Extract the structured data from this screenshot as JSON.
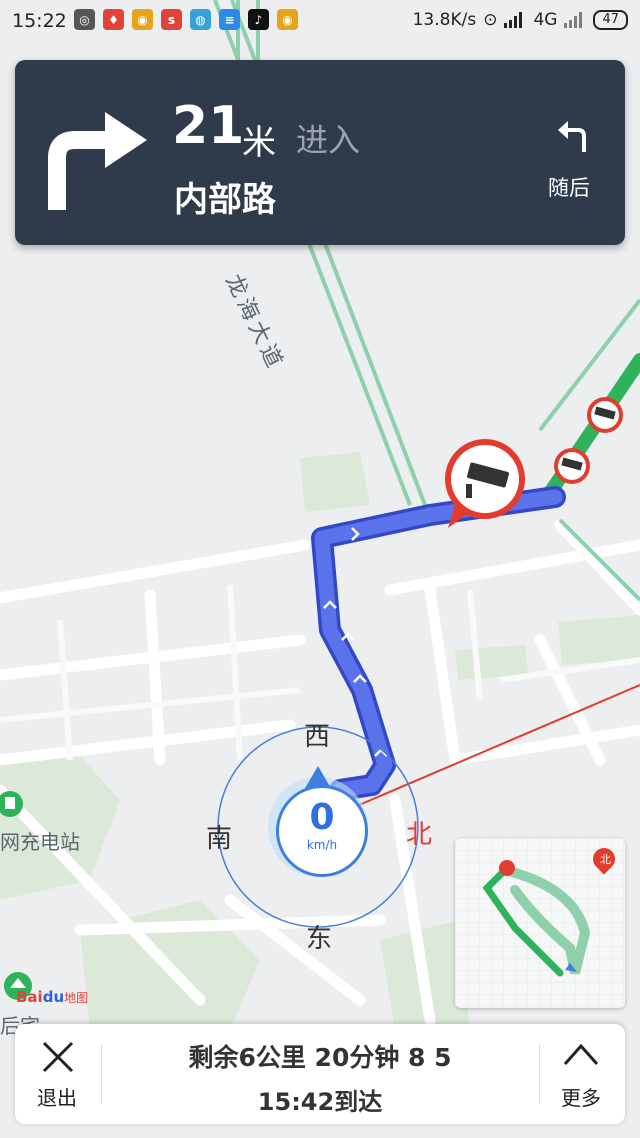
{
  "status_bar": {
    "time": "15:22",
    "net_speed": "13.8K/s",
    "network": "4G",
    "battery": "47",
    "apps": [
      {
        "icon": "map-pin-app-icon",
        "color": "#555555",
        "label": "◎"
      },
      {
        "icon": "location-app-icon",
        "color": "#e0433a",
        "label": "♦"
      },
      {
        "icon": "weibo-app-icon",
        "color": "#e6a41b",
        "label": "◉"
      },
      {
        "icon": "sina-app-icon",
        "color": "#e0433a",
        "label": "s"
      },
      {
        "icon": "round-app-icon",
        "color": "#3aa0d8",
        "label": "◍"
      },
      {
        "icon": "notes-app-icon",
        "color": "#2d8ae6",
        "label": "≡"
      },
      {
        "icon": "tiktok-app-icon",
        "color": "#111111",
        "label": "♪"
      },
      {
        "icon": "weibo-app-icon-2",
        "color": "#e6a41b",
        "label": "◉"
      }
    ]
  },
  "guidance": {
    "distance": "21",
    "unit": "米",
    "action": "进入",
    "road": "内部路",
    "later_label": "随后"
  },
  "map": {
    "road_label": "龙海大道",
    "poi_label": "网充电站",
    "poi_label_2": "后宅",
    "compass": {
      "west": "西",
      "south": "南",
      "north": "北",
      "east": "东"
    },
    "speed": "0",
    "speed_unit": "km/h",
    "minimap_north": "北",
    "logo_bai": "Bai",
    "logo_du": "du",
    "logo_map": "地图"
  },
  "bottom": {
    "exit_label": "退出",
    "remaining": "剩余6公里 20分钟 8 5",
    "arrival": "15:42到达",
    "more_label": "更多"
  },
  "colors": {
    "route": "#4a63e0",
    "traffic": "#2eb35a",
    "camera_red": "#e33b2e",
    "card_bg": "#2f3a4a"
  }
}
